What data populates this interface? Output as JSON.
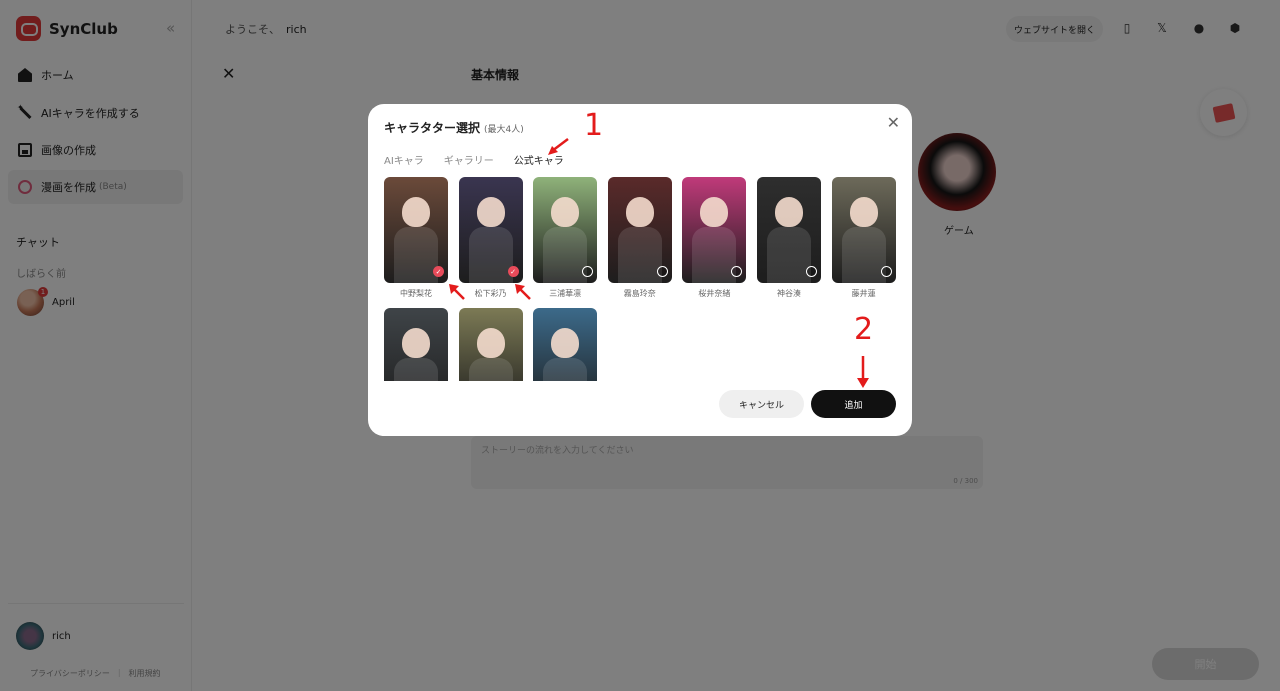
{
  "brand": {
    "name": "SynClub"
  },
  "sidebar": {
    "nav": [
      {
        "label": "ホーム",
        "icon": "home-icon"
      },
      {
        "label": "AIキャラを作成する",
        "icon": "wand-icon"
      },
      {
        "label": "画像の作成",
        "icon": "image-icon"
      },
      {
        "label": "漫画を作成",
        "beta": "(Beta)",
        "icon": "manga-icon"
      }
    ],
    "chat_title": "チャット",
    "recent_label": "しばらく前",
    "chat_item": {
      "name": "April",
      "badge": "1"
    },
    "user": {
      "name": "rich"
    },
    "footer": {
      "privacy": "プライバシーポリシー",
      "terms": "利用規約"
    }
  },
  "header": {
    "greeting": "ようこそ、",
    "username": "rich",
    "open_site": "ウェブサイトを開く"
  },
  "main": {
    "title": "基本情報",
    "character_label": "ゲーム",
    "story_placeholder": "ストーリーの流れを入力してください",
    "story_count": "0 / 300",
    "start_button": "開始"
  },
  "modal": {
    "title": "キャラタター選択",
    "limit": "(最大4人)",
    "tabs": [
      "AIキャラ",
      "ギャラリー",
      "公式キャラ"
    ],
    "active_tab": "公式キャラ",
    "characters": [
      {
        "name": "中野梨花",
        "selected": true,
        "color": "#6b4a3a"
      },
      {
        "name": "松下彩乃",
        "selected": true,
        "color": "#3a3550"
      },
      {
        "name": "三浦華凛",
        "selected": false,
        "color": "#8fb27a"
      },
      {
        "name": "霧島玲奈",
        "selected": false,
        "color": "#5a2a2a"
      },
      {
        "name": "桜井奈緒",
        "selected": false,
        "color": "#c03a7a"
      },
      {
        "name": "神谷湊",
        "selected": false,
        "color": "#2e2e2e"
      },
      {
        "name": "藤井蓮",
        "selected": false,
        "color": "#6d6a5a"
      },
      {
        "name": "",
        "selected": false,
        "color": "#3f4448"
      },
      {
        "name": "",
        "selected": false,
        "color": "#7c7a55"
      },
      {
        "name": "",
        "selected": false,
        "color": "#3c6a8a"
      }
    ],
    "cancel_label": "キャンセル",
    "add_label": "追加"
  },
  "annotations": {
    "step1": "1",
    "step2": "2",
    "color": "#e31b1b"
  }
}
